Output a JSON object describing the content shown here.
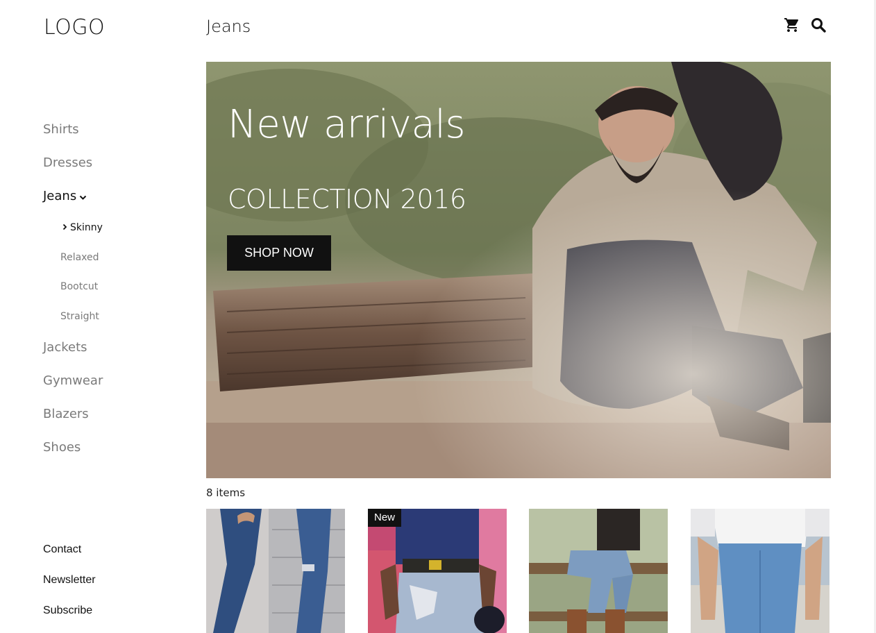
{
  "header": {
    "logo": "LOGO",
    "page_title": "Jeans",
    "cart_icon": "cart-icon",
    "search_icon": "search-icon"
  },
  "sidebar": {
    "categories": [
      {
        "label": "Shirts"
      },
      {
        "label": "Dresses"
      },
      {
        "label": "Jeans",
        "active": true,
        "icon": "chevron-down-icon"
      },
      {
        "label": "Jackets"
      },
      {
        "label": "Gymwear"
      },
      {
        "label": "Blazers"
      },
      {
        "label": "Shoes"
      }
    ],
    "subcategories": [
      {
        "label": "Skinny",
        "active": true,
        "icon": "chevron-right-icon"
      },
      {
        "label": "Relaxed"
      },
      {
        "label": "Bootcut"
      },
      {
        "label": "Straight"
      }
    ],
    "footer_links": [
      {
        "label": "Contact"
      },
      {
        "label": "Newsletter"
      },
      {
        "label": "Subscribe"
      }
    ]
  },
  "hero": {
    "title": "New arrivals",
    "subtitle": "COLLECTION 2016",
    "button_label": "SHOP NOW"
  },
  "products": {
    "count_label": "8 items",
    "badge_label": "New"
  },
  "colors": {
    "text": "#111111",
    "muted": "#7a7a7a",
    "button_bg": "#111111",
    "button_text": "#ffffff"
  }
}
